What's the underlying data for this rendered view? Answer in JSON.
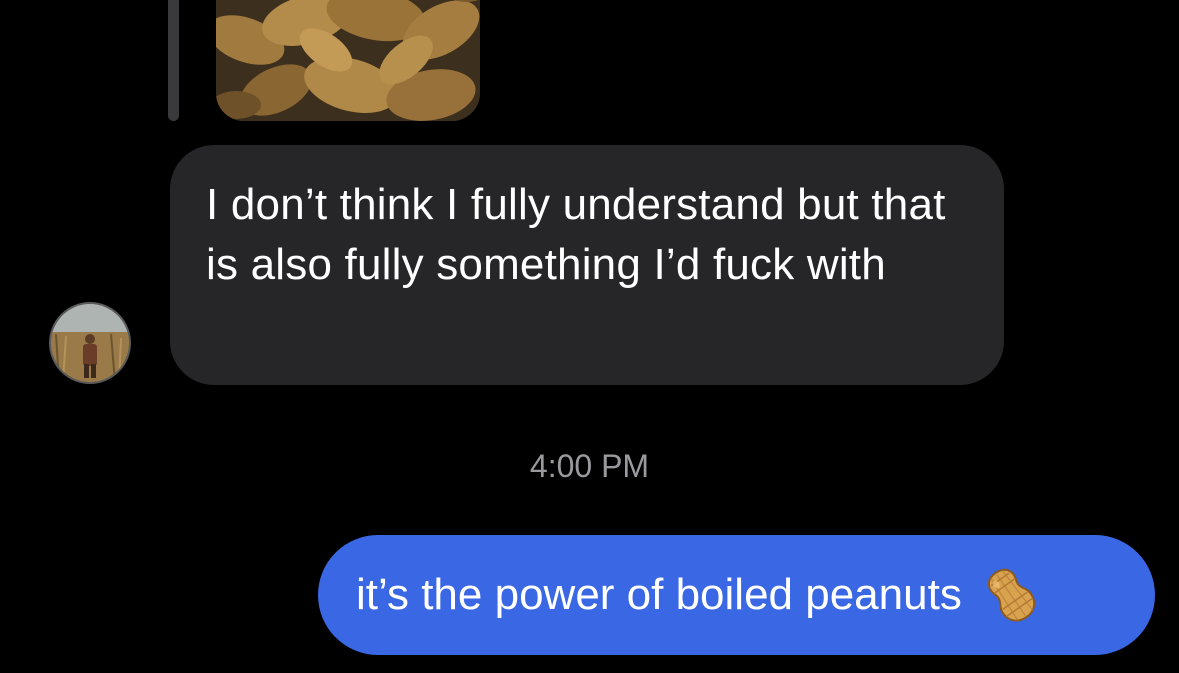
{
  "conversation": {
    "received": {
      "photo_icon": "boiled-peanuts-photo",
      "message": "I don’t think I fully understand but that is also fully something I’d fuck with",
      "avatar_icon": "contact-avatar"
    },
    "timestamp": "4:00 PM",
    "sent": {
      "message": "it’s the power of boiled peanuts",
      "emoji_icon": "peanut-emoji"
    }
  },
  "colors": {
    "background": "#000000",
    "received_bubble": "#262628",
    "sent_bubble": "#3a67e4",
    "timestamp_text": "#9a9a9e"
  }
}
